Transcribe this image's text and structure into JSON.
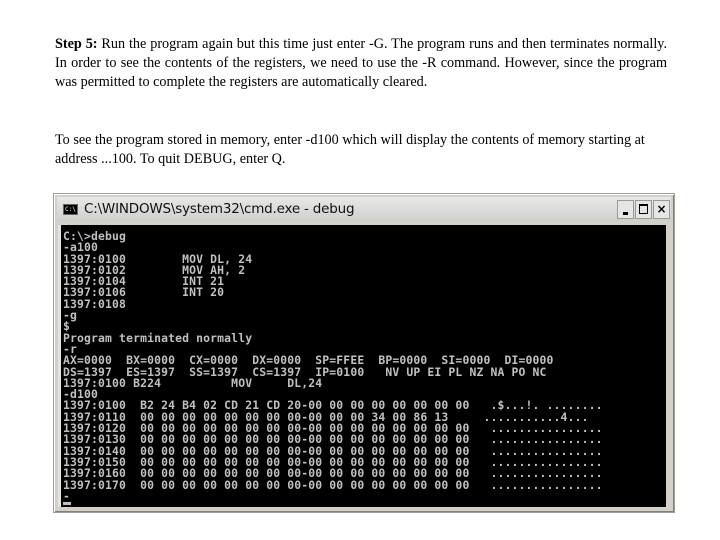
{
  "document": {
    "paragraph1": {
      "label": "Step 5:",
      "text": " Run the program again but this time just enter -G.  The program runs and then terminates normally. In order to see the contents of the registers, we need to use the -R command.  However, since the program was permitted to complete the registers are automatically cleared."
    },
    "paragraph2": "To see the program stored in memory, enter -d100 which will display the contents of memory starting at address ...100.  To quit DEBUG, enter Q."
  },
  "window": {
    "title": "C:\\WINDOWS\\system32\\cmd.exe - debug",
    "icon_text": "C:\\",
    "controls": {
      "minimize": "minimize-icon",
      "maximize": "maximize-icon",
      "close": "×"
    },
    "console_lines": [
      "C:\\>debug",
      "-a100",
      "1397:0100        MOV DL, 24",
      "1397:0102        MOV AH, 2",
      "1397:0104        INT 21",
      "1397:0106        INT 20",
      "1397:0108",
      "-g",
      "$",
      "Program terminated normally",
      "-r",
      "AX=0000  BX=0000  CX=0000  DX=0000  SP=FFEE  BP=0000  SI=0000  DI=0000",
      "DS=1397  ES=1397  SS=1397  CS=1397  IP=0100   NV UP EI PL NZ NA PO NC",
      "1397:0100 B224          MOV     DL,24",
      "-d100",
      "1397:0100  B2 24 B4 02 CD 21 CD 20-00 00 00 00 00 00 00 00   .$...!. ........",
      "1397:0110  00 00 00 00 00 00 00 00-00 00 00 34 00 86 13     ...........4...",
      "1397:0120  00 00 00 00 00 00 00 00-00 00 00 00 00 00 00 00   ................",
      "1397:0130  00 00 00 00 00 00 00 00-00 00 00 00 00 00 00 00   ................",
      "1397:0140  00 00 00 00 00 00 00 00-00 00 00 00 00 00 00 00   ................",
      "1397:0150  00 00 00 00 00 00 00 00-00 00 00 00 00 00 00 00   ................",
      "1397:0160  00 00 00 00 00 00 00 00-00 00 00 00 00 00 00 00   ................",
      "1397:0170  00 00 00 00 00 00 00 00-00 00 00 00 00 00 00 00   ................",
      "-"
    ]
  }
}
